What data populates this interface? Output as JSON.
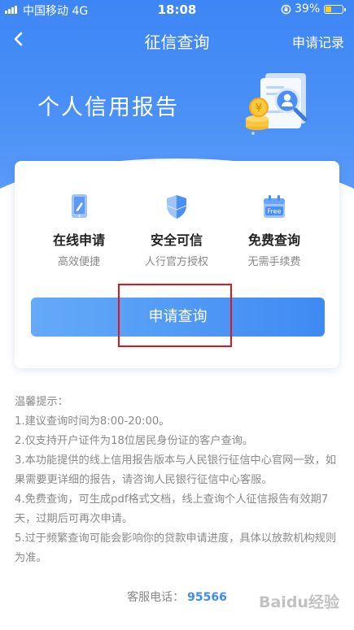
{
  "status_bar": {
    "carrier": "中国移动  4G",
    "time": "18:08",
    "battery_percent": "39%",
    "battery_level": 0.39
  },
  "navbar": {
    "title": "征信查询",
    "records_link": "申请记录"
  },
  "hero": {
    "title": "个人信用报告"
  },
  "features": [
    {
      "icon": "phone-pen-icon",
      "title": "在线申请",
      "subtitle": "高效便捷"
    },
    {
      "icon": "shield-icon",
      "title": "安全可信",
      "subtitle": "人行官方授权"
    },
    {
      "icon": "calendar-free-icon",
      "title": "免费查询",
      "subtitle": "无需手续费",
      "badge": "Free"
    }
  ],
  "apply_button": "申请查询",
  "tips": {
    "heading": "温馨提示：",
    "items": [
      "1.建议查询时间为8:00-20:00。",
      "2.仅支持开户证件为18位居民身份证的客户查询。",
      "3.本功能提供的线上信用报告版本与人民银行征信中心官网一致，如果需要更详细的报告，请咨询人民银行征信中心客服。",
      "4.免费查询，可生成pdf格式文档，线上查询个人征信报告有效期7天，过期后可再次申请。",
      "5.过于频繁查询可能会影响你的贷款申请进度，具体以放款机构规则为准。"
    ]
  },
  "service": {
    "label": "客服电话：",
    "number": "95566"
  },
  "watermark": "Baidu经验",
  "colors": {
    "primary": "#3f8af3",
    "highlight": "#e0161b",
    "battery": "#ffd21e"
  }
}
